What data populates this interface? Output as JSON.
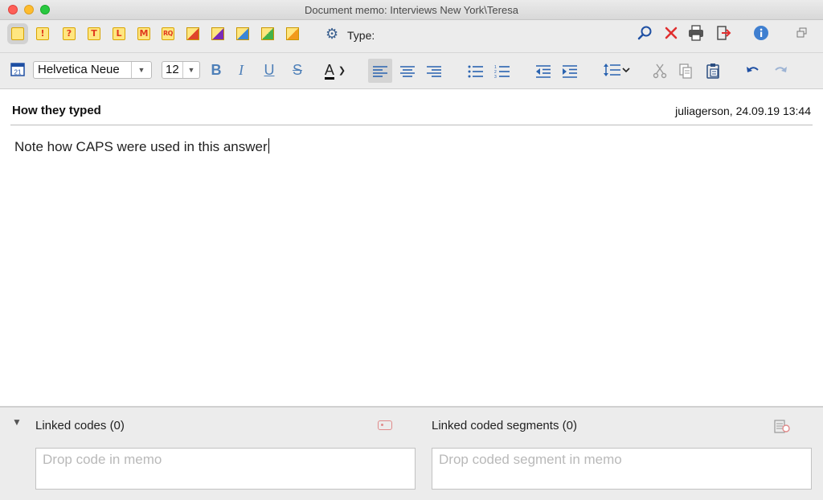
{
  "window": {
    "title": "Document memo: Interviews New York\\Teresa"
  },
  "toolbar": {
    "memo_icons": [
      {
        "name": "memo-default-icon",
        "glyph": ""
      },
      {
        "name": "memo-exclamation-icon",
        "glyph": "!"
      },
      {
        "name": "memo-question-icon",
        "glyph": "?"
      },
      {
        "name": "memo-t-icon",
        "glyph": "T"
      },
      {
        "name": "memo-l-icon",
        "glyph": "L"
      },
      {
        "name": "memo-m-icon",
        "glyph": "M"
      },
      {
        "name": "memo-rq-icon",
        "glyph": "RQ"
      }
    ],
    "type_label": "Type:",
    "flag_colors": [
      "#e0452b",
      "#7a2bb8",
      "#3b86d6",
      "#44b24a",
      "#f29a1c"
    ]
  },
  "format": {
    "font": "Helvetica Neue",
    "size": "12",
    "bold": "B",
    "italic": "I",
    "underline": "U",
    "strike": "S",
    "color_letter": "A"
  },
  "memo": {
    "title": "How they typed",
    "meta": "juliagerson, 24.09.19 13:44",
    "text": "Note how CAPS were used in this answer"
  },
  "linked": {
    "codes_label": "Linked codes (0)",
    "segments_label": "Linked coded segments (0)",
    "codes_placeholder": "Drop code in memo",
    "segments_placeholder": "Drop coded segment in memo"
  }
}
